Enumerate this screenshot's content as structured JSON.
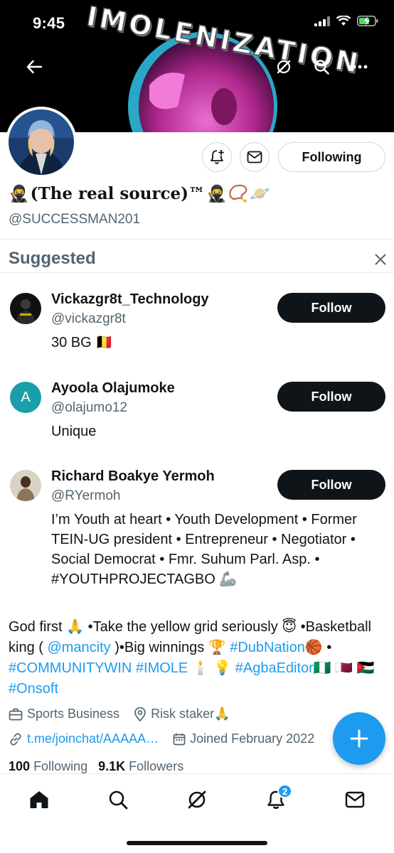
{
  "status_bar": {
    "time": "9:45"
  },
  "banner": {
    "text": "IMOLENIZATION",
    "icons": [
      "back-arrow-icon",
      "grok-icon",
      "search-icon",
      "more-icon"
    ]
  },
  "profile": {
    "display_name": "(The real source)™",
    "handle": "@SUCCESSMAN201",
    "following_label": "Following",
    "action_icons": [
      "notification-add-icon",
      "mail-icon"
    ]
  },
  "suggested": {
    "title": "Suggested",
    "items": [
      {
        "name": "Vickazgr8t_Technology",
        "handle": "@vickazgr8t",
        "bio": "30 BG 🇧🇪",
        "button": "Follow"
      },
      {
        "name": "Ayoola Olajumoke",
        "handle": "@olajumo12",
        "bio": "Unique",
        "button": "Follow",
        "avatar_letter": "A"
      },
      {
        "name": "Richard Boakye Yermoh",
        "handle": "@RYermoh",
        "bio": "I’m Youth at heart • Youth Development • Former TEIN-UG president • Entrepreneur • Negotiator • Social Democrat • Fmr. Suhum Parl. Asp. • #YOUTHPROJECTAGBO 🦾",
        "button": "Follow"
      }
    ]
  },
  "bio": {
    "part1": "God first 🙏 •Take the yellow grid seriously 😇 •Basketball king ( ",
    "mention": "@mancity",
    "part2": " )•Big winnings 🏆 ",
    "tag1": "#DubNation",
    "part3": "🏀 • ",
    "tag2": "#COMMUNITYWIN",
    "part4": " ",
    "tag3": "#IMOLE",
    "part5": " 🕯️ 💡 ",
    "tag4": "#AgbaEditor",
    "part6": "🇳🇬 🇶🇦 🇯🇴 ",
    "tag5": "#Onsoft"
  },
  "meta": {
    "category": "Sports Business",
    "location": "Risk staker🙏",
    "link": "t.me/joinchat/AAAAA…",
    "joined": "Joined February 2022"
  },
  "counts": {
    "following_num": "100",
    "following_label": "Following",
    "followers_num": "9.1K",
    "followers_label": "Followers"
  },
  "tabbar": {
    "notifications_badge": "2",
    "items": [
      "home-icon",
      "search-icon",
      "grok-icon",
      "notifications-icon",
      "messages-icon"
    ]
  },
  "colors": {
    "accent": "#1d9bf0",
    "text": "#0f1419",
    "secondary": "#536471",
    "button_dark": "#0f1419"
  }
}
